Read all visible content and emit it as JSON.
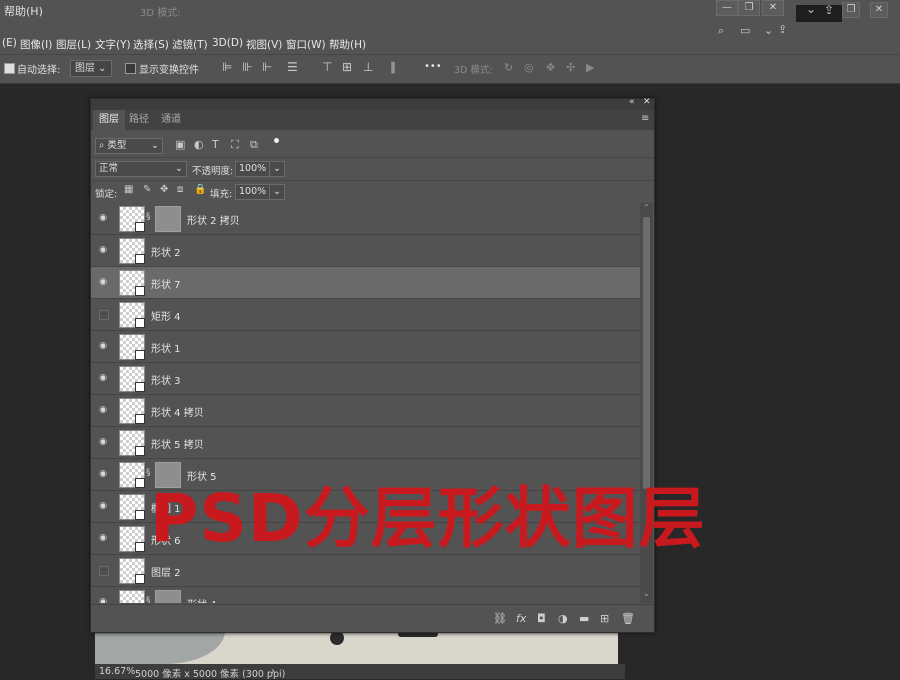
{
  "top_strip": {
    "title": "帮助(H)",
    "ghost_mode": "3D 模式:"
  },
  "menu": [
    "(E)",
    "图像(I)",
    "图层(L)",
    "文字(Y)",
    "选择(S)",
    "滤镜(T)",
    "3D(D)",
    "视图(V)",
    "窗口(W)",
    "帮助(H)"
  ],
  "options_bar": {
    "auto_select_label": "自动选择:",
    "auto_select_value": "图层",
    "show_transform_label": "显示变换控件",
    "more": "•••",
    "mode_3d_label": "3D 模式:"
  },
  "panel": {
    "tabs": [
      "图层",
      "路径",
      "通道"
    ],
    "filter_kind": "类型",
    "blend_mode": "正常",
    "opacity_label": "不透明度:",
    "opacity_value": "100%",
    "lock_label": "锁定:",
    "fill_label": "填充:",
    "fill_value": "100%"
  },
  "layers": [
    {
      "name": "形状 2 拷贝",
      "visible": true,
      "mask": true,
      "selected": false
    },
    {
      "name": "形状 2",
      "visible": true,
      "mask": false,
      "selected": false
    },
    {
      "name": "形状 7",
      "visible": true,
      "mask": false,
      "selected": true
    },
    {
      "name": "矩形 4",
      "visible": false,
      "mask": false,
      "selected": false
    },
    {
      "name": "形状 1",
      "visible": true,
      "mask": false,
      "selected": false
    },
    {
      "name": "形状 3",
      "visible": true,
      "mask": false,
      "selected": false
    },
    {
      "name": "形状 4 拷贝",
      "visible": true,
      "mask": false,
      "selected": false
    },
    {
      "name": "形状 5 拷贝",
      "visible": true,
      "mask": false,
      "selected": false
    },
    {
      "name": "形状 5",
      "visible": true,
      "mask": true,
      "selected": false
    },
    {
      "name": "椭圆 1",
      "visible": true,
      "mask": false,
      "selected": false
    },
    {
      "name": "形状 6",
      "visible": true,
      "mask": false,
      "selected": false
    },
    {
      "name": "图层 2",
      "visible": false,
      "mask": false,
      "selected": false
    },
    {
      "name": "形状 4",
      "visible": true,
      "mask": true,
      "selected": false
    }
  ],
  "status": {
    "zoom": "16.67%",
    "doc_info": "5000 像素 x 5000 像素 (300 ppi)"
  },
  "overlay_text": "PSD分层形状图层",
  "colors": {
    "overlay": "#c8191e",
    "panel": "#535353",
    "selected_row": "#6a6a6a"
  }
}
